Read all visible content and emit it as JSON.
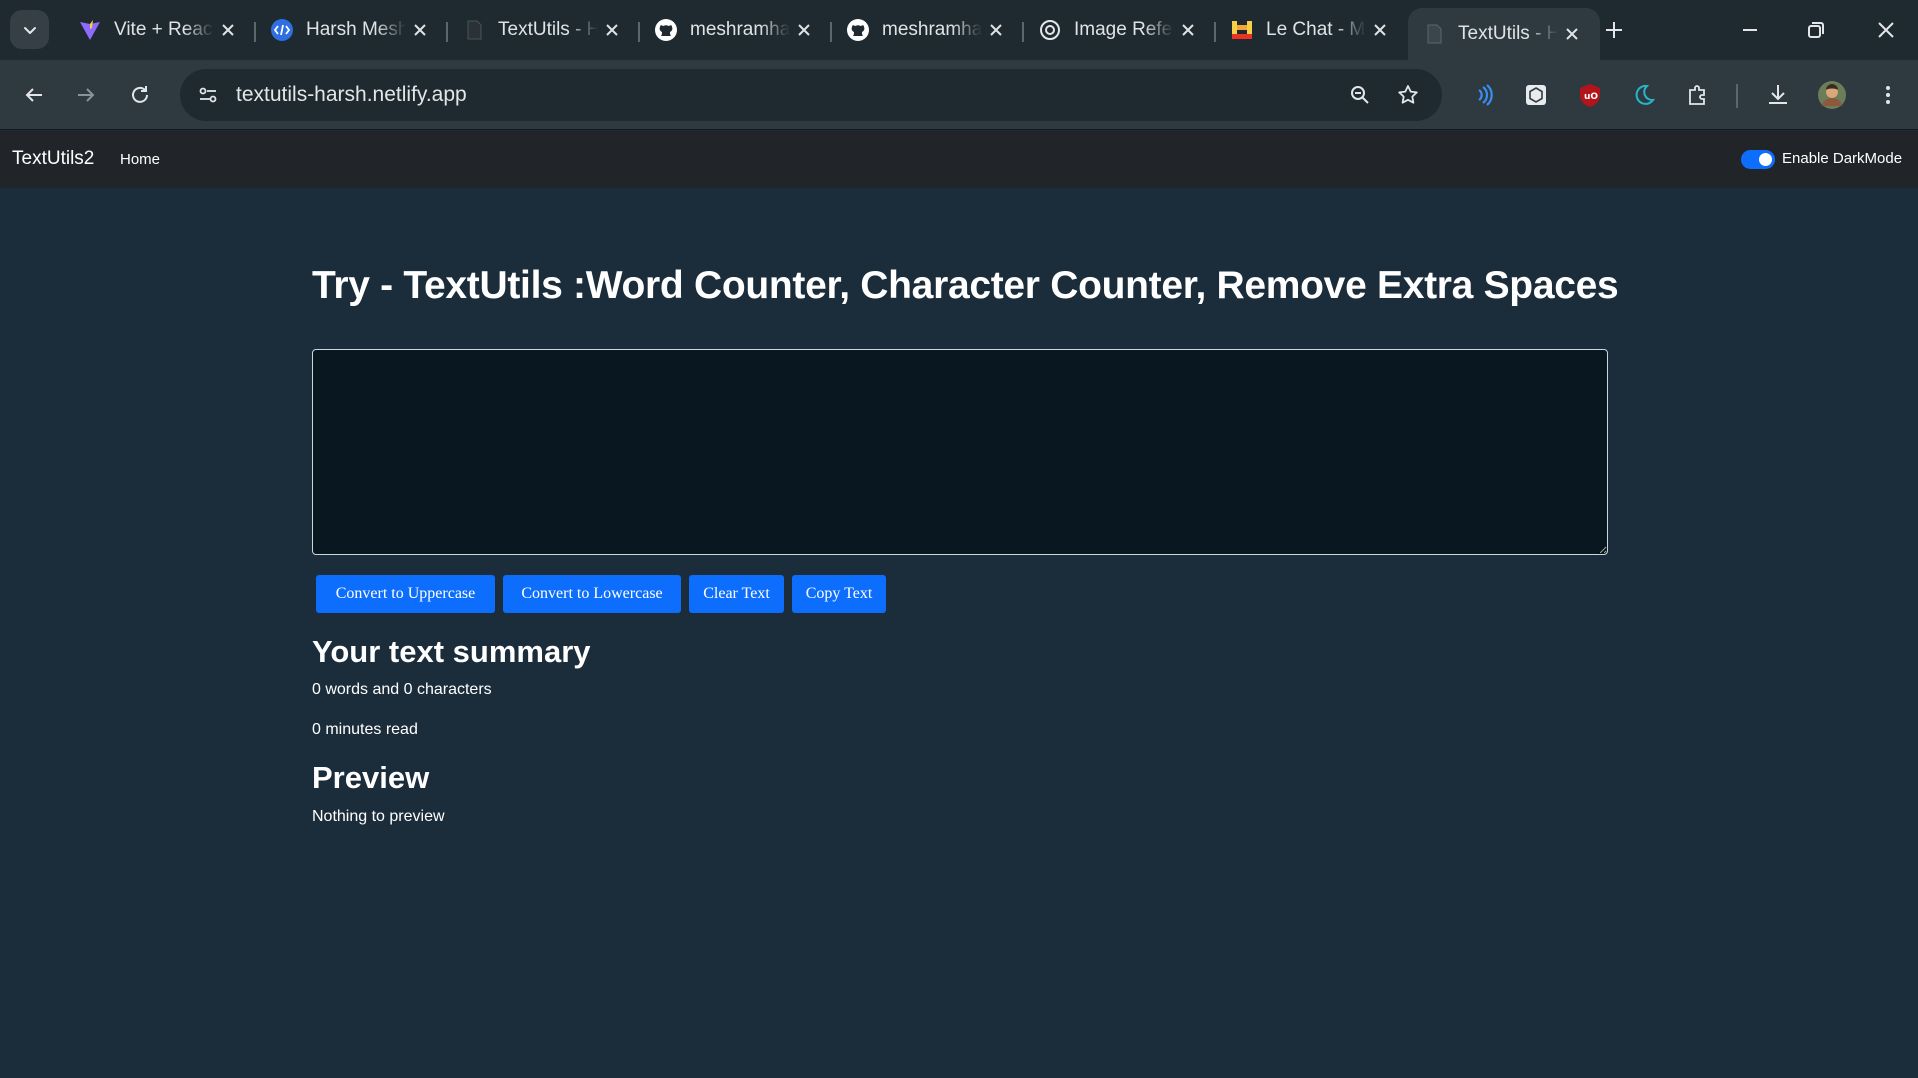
{
  "browser": {
    "tabs": [
      {
        "title": "Vite + React",
        "favicon": "vite-icon",
        "active": false
      },
      {
        "title": "Harsh Meshram",
        "favicon": "code-icon",
        "active": false
      },
      {
        "title": "TextUtils - Home",
        "favicon": "page-icon",
        "active": false
      },
      {
        "title": "meshramharsh",
        "favicon": "github-icon",
        "active": false
      },
      {
        "title": "meshramharsh",
        "favicon": "github-icon",
        "active": false
      },
      {
        "title": "Image Reference",
        "favicon": "openai-icon",
        "active": false
      },
      {
        "title": "Le Chat - Mistral",
        "favicon": "mistral-icon",
        "active": false
      },
      {
        "title": "TextUtils - Home",
        "favicon": "page-icon",
        "active": true
      }
    ],
    "url": "textutils-harsh.netlify.app",
    "colors": {
      "accent": "#0d6efd",
      "page_bg": "#1b2c3b",
      "navbar_bg": "#212529"
    }
  },
  "navbar": {
    "brand": "TextUtils2",
    "home_link": "Home",
    "darkmode_label": "Enable DarkMode",
    "darkmode_enabled": true
  },
  "main": {
    "heading": "Try - TextUtils :Word Counter, Character Counter, Remove Extra Spaces",
    "textarea_value": "",
    "buttons": {
      "uppercase": "Convert to Uppercase",
      "lowercase": "Convert to Lowercase",
      "clear": "Clear Text",
      "copy": "Copy Text"
    },
    "summary": {
      "title": "Your text summary",
      "counts": "0 words and 0 characters",
      "read_time": "0 minutes read"
    },
    "preview": {
      "title": "Preview",
      "text": "Nothing to preview"
    }
  }
}
